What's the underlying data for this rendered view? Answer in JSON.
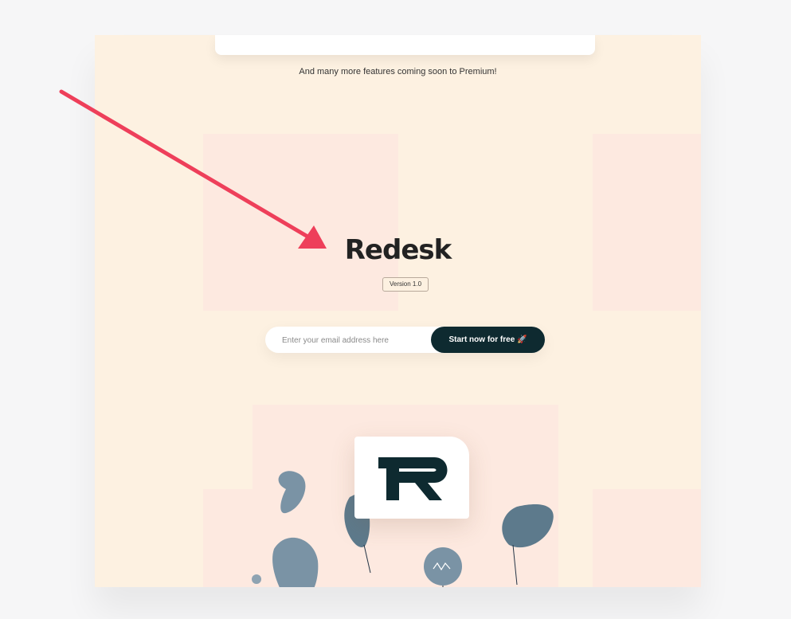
{
  "premium": {
    "more_features_text": "And many more features coming soon to Premium!"
  },
  "hero": {
    "brand_name": "Redesk",
    "version_badge": "Version 1.0"
  },
  "signup": {
    "email_placeholder": "Enter your email address here",
    "email_value": "",
    "cta_label": "Start now for free 🚀"
  },
  "logo": {
    "letters": "R"
  },
  "colors": {
    "page_background": "#fdf1e1",
    "tile_pink": "#fde9e0",
    "button_dark": "#0e2a30",
    "arrow_red": "#ee3f5a",
    "plant_blue": "#7a93a5",
    "brand_text": "#222222"
  },
  "icons": [
    "rocket-icon",
    "arrow-annotation",
    "plant-illustration",
    "redesk-logo-icon"
  ]
}
